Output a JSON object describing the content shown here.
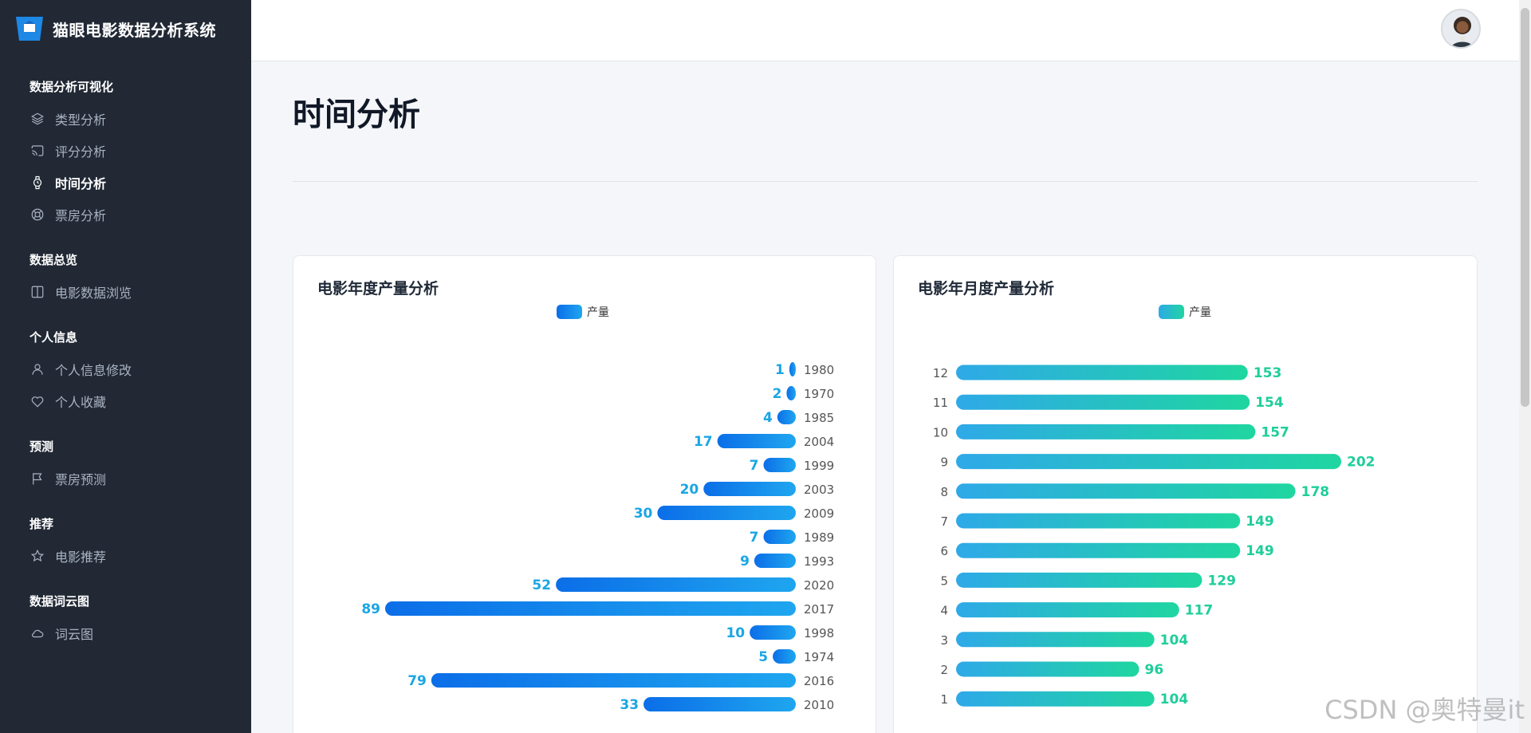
{
  "app": {
    "title": "猫眼电影数据分析系统"
  },
  "sidebar": {
    "sections": [
      {
        "title": "数据分析可视化",
        "items": [
          {
            "label": "类型分析",
            "icon": "layers-icon",
            "active": false
          },
          {
            "label": "评分分析",
            "icon": "cast-icon",
            "active": false
          },
          {
            "label": "时间分析",
            "icon": "watch-icon",
            "active": true
          },
          {
            "label": "票房分析",
            "icon": "lifebuoy-icon",
            "active": false
          }
        ]
      },
      {
        "title": "数据总览",
        "items": [
          {
            "label": "电影数据浏览",
            "icon": "columns-icon",
            "active": false
          }
        ]
      },
      {
        "title": "个人信息",
        "items": [
          {
            "label": "个人信息修改",
            "icon": "user-icon",
            "active": false
          },
          {
            "label": "个人收藏",
            "icon": "heart-icon",
            "active": false
          }
        ]
      },
      {
        "title": "预测",
        "items": [
          {
            "label": "票房预测",
            "icon": "flag-icon",
            "active": false
          }
        ]
      },
      {
        "title": "推荐",
        "items": [
          {
            "label": "电影推荐",
            "icon": "star-icon",
            "active": false
          }
        ]
      },
      {
        "title": "数据词云图",
        "items": [
          {
            "label": "词云图",
            "icon": "cloud-icon",
            "active": false
          }
        ]
      }
    ]
  },
  "page": {
    "title": "时间分析"
  },
  "watermark": "CSDN @奥特曼it",
  "chart_data": [
    {
      "type": "bar",
      "orientation": "horizontal",
      "title": "电影年度产量分析",
      "legend": "产量",
      "direction": "right-to-left",
      "categories": [
        "1980",
        "1970",
        "1985",
        "2004",
        "1999",
        "2003",
        "2009",
        "1989",
        "1993",
        "2020",
        "2017",
        "1998",
        "1974",
        "2016",
        "2010"
      ],
      "series": [
        {
          "name": "产量",
          "values": [
            1,
            2,
            4,
            17,
            7,
            20,
            30,
            7,
            9,
            52,
            89,
            10,
            5,
            79,
            33
          ]
        }
      ],
      "colors": {
        "start": "#0b6ee8",
        "end": "#1fa6ef",
        "label": "#1aa6e4"
      }
    },
    {
      "type": "bar",
      "orientation": "horizontal",
      "title": "电影年月度产量分析",
      "legend": "产量",
      "direction": "left-to-right",
      "categories": [
        "12",
        "11",
        "10",
        "9",
        "8",
        "7",
        "6",
        "5",
        "4",
        "3",
        "2",
        "1"
      ],
      "series": [
        {
          "name": "产量",
          "values": [
            153,
            154,
            157,
            202,
            178,
            149,
            149,
            129,
            117,
            104,
            96,
            104
          ]
        }
      ],
      "colors": {
        "start": "#2ea9e8",
        "end": "#1fd6a0",
        "label": "#1fce9a"
      }
    }
  ]
}
